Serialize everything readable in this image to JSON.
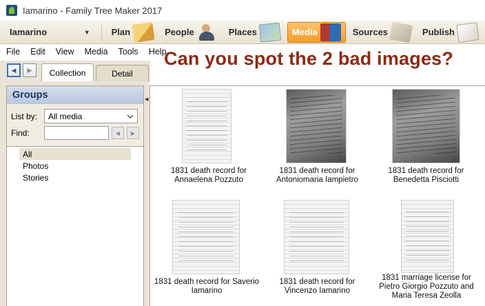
{
  "window": {
    "title": "Iamarino - Family Tree Maker 2017"
  },
  "navbar": {
    "tree_name": "Iamarino",
    "items": [
      {
        "label": "Plan",
        "icon": "plan-icon"
      },
      {
        "label": "People",
        "icon": "people-icon"
      },
      {
        "label": "Places",
        "icon": "places-icon"
      },
      {
        "label": "Media",
        "icon": "media-icon",
        "active": true
      },
      {
        "label": "Sources",
        "icon": "sources-icon"
      },
      {
        "label": "Publish",
        "icon": "publish-icon"
      }
    ]
  },
  "menu": [
    "File",
    "Edit",
    "View",
    "Media",
    "Tools",
    "Help"
  ],
  "banner": "Can you spot the 2 bad images?",
  "tabs": {
    "collection": "Collection",
    "detail": "Detail"
  },
  "groups": {
    "title": "Groups",
    "list_by_label": "List by:",
    "list_by_value": "All media",
    "find_label": "Find:",
    "find_value": "",
    "items": [
      "All",
      "Photos",
      "Stories"
    ],
    "selected": "All"
  },
  "media": [
    {
      "caption": "1831 death record for Annaelena Pozzuto"
    },
    {
      "caption": "1831 death record for Antoniomaria Iampietro"
    },
    {
      "caption": "1831 death record for Benedetta Pisciotti"
    },
    {
      "caption": "1831 death record for Saverio Iamarino"
    },
    {
      "caption": "1831 death record for Vincenzo Iamarino"
    },
    {
      "caption": "1831 marriage license for Pietro Giorgio Pozzuto and Maria Teresa Zeolla"
    }
  ],
  "colors": {
    "banner": "#8e2a16",
    "active_tab": "#f29d2b",
    "groups_header": "#1f3864"
  }
}
